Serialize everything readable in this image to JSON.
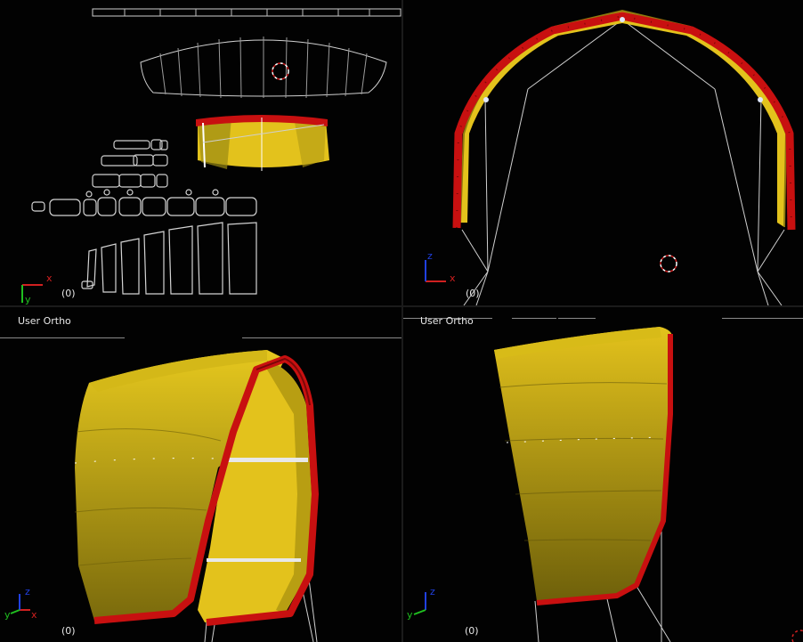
{
  "viewports": {
    "top_left": {
      "frame": "(0)",
      "axis": {
        "primary": "x",
        "secondary": "y"
      }
    },
    "top_right": {
      "frame": "(0)",
      "axis": {
        "primary": "x",
        "secondary": "z"
      }
    },
    "bottom_left": {
      "label": "User Ortho",
      "frame": "(0)",
      "axis": {
        "primary": "x",
        "secondary": "y",
        "up": "z"
      }
    },
    "bottom_right": {
      "label": "User Ortho",
      "frame": "(0)",
      "axis": {
        "up": "z",
        "secondary": "y"
      }
    }
  },
  "colors": {
    "background": "#020202",
    "wire": "#d8d8d8",
    "kite_yellow": "#e3c21c",
    "kite_yellow_dark": "#8a7a10",
    "leading_edge_red": "#c81010",
    "axis_x": "#d02020",
    "axis_y": "#20c020",
    "axis_z": "#2040e0",
    "cursor": "#d02020"
  }
}
